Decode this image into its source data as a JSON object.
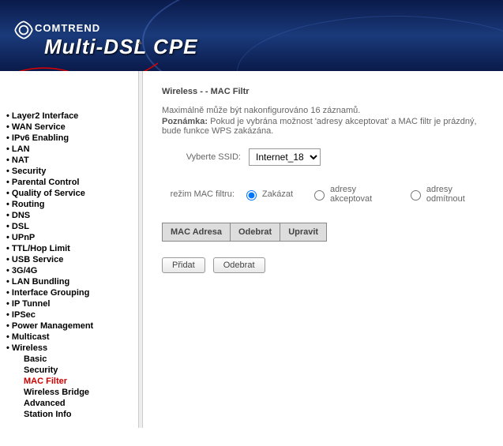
{
  "header": {
    "brand": "COMTREND",
    "product": "Multi-DSL CPE"
  },
  "sidebar": {
    "items": [
      {
        "label": "Layer2 Interface"
      },
      {
        "label": "WAN Service"
      },
      {
        "label": "IPv6 Enabling"
      },
      {
        "label": "LAN"
      },
      {
        "label": "NAT"
      },
      {
        "label": "Security"
      },
      {
        "label": "Parental Control"
      },
      {
        "label": "Quality of Service"
      },
      {
        "label": "Routing"
      },
      {
        "label": "DNS"
      },
      {
        "label": "DSL"
      },
      {
        "label": "UPnP"
      },
      {
        "label": "TTL/Hop Limit"
      },
      {
        "label": "USB Service"
      },
      {
        "label": "3G/4G"
      },
      {
        "label": "LAN Bundling"
      },
      {
        "label": "Interface Grouping"
      },
      {
        "label": "IP Tunnel"
      },
      {
        "label": "IPSec"
      },
      {
        "label": "Power Management"
      },
      {
        "label": "Multicast"
      },
      {
        "label": "Wireless"
      }
    ],
    "wireless_children": [
      {
        "label": "Basic"
      },
      {
        "label": "Security"
      },
      {
        "label": "MAC Filter",
        "active": true
      },
      {
        "label": "Wireless Bridge"
      },
      {
        "label": "Advanced"
      },
      {
        "label": "Station Info"
      }
    ]
  },
  "page": {
    "title": "Wireless - - MAC Filtr",
    "info": "Maximálně může být nakonfigurováno 16 záznamů.",
    "note_label": "Poznámka:",
    "note_text": " Pokud je vybrána možnost 'adresy akceptovat' a MAC filtr je prázdný, bude funkce WPS zakázána.",
    "ssid_label": "Vyberte SSID:",
    "ssid_value": "Internet_18",
    "mode_label": "režim MAC filtru:",
    "mode_options": {
      "disable": "Zakázat",
      "allow": "adresy akceptovat",
      "deny": "adresy odmítnout"
    },
    "table": {
      "col_mac": "MAC Adresa",
      "col_remove": "Odebrat",
      "col_edit": "Upravit"
    },
    "buttons": {
      "add": "Přidat",
      "remove": "Odebrat"
    }
  }
}
